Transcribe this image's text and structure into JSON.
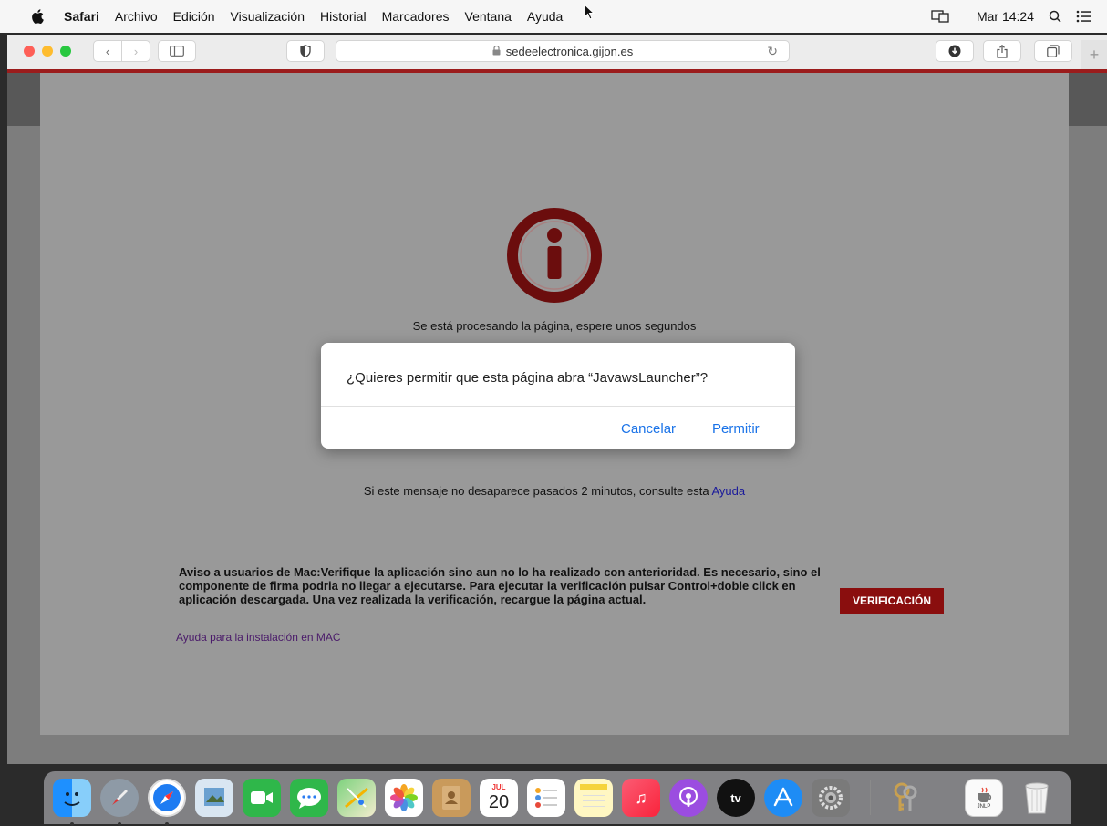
{
  "menubar": {
    "app_name": "Safari",
    "items": [
      "Archivo",
      "Edición",
      "Visualización",
      "Historial",
      "Marcadores",
      "Ventana",
      "Ayuda"
    ],
    "clock": "Mar 14:24"
  },
  "toolbar": {
    "url": "sedeelectronica.gijon.es"
  },
  "page": {
    "processing_text": "Se está procesando la página, espere unos segundos",
    "help_text": "Si este mensaje no desaparece pasados 2 minutos, consulte esta ",
    "help_link": "Ayuda",
    "notice": "Aviso a usuarios de Mac:Verifique la aplicación sino aun no lo ha realizado con anterioridad. Es necesario, sino el componente de firma podria no llegar a ejecutarse. Para ejecutar la verificación pulsar Control+doble click en aplicación descargada. Una vez realizada la verificación, recargue la página actual.",
    "mac_help_link": "Ayuda para la instalación en MAC",
    "verify_button": "VERIFICACIÓN",
    "accent_color": "#8a0e0e"
  },
  "dialog": {
    "question": "¿Quieres permitir que esta página abra “JavawsLauncher”?",
    "cancel_label": "Cancelar",
    "allow_label": "Permitir"
  },
  "dock": {
    "icons": [
      "finder-icon",
      "launchpad-icon",
      "safari-icon",
      "preview-icon",
      "facetime-icon",
      "messages-icon",
      "maps-icon",
      "photos-icon",
      "contacts-icon",
      "calendar-icon",
      "reminders-icon",
      "notes-icon",
      "music-icon",
      "podcasts-icon",
      "apple-tv-icon",
      "app-store-icon",
      "system-preferences-icon",
      "keychain-icon",
      "jnlp-file-icon",
      "trash-icon"
    ],
    "calendar_month": "JUL",
    "calendar_day": "20",
    "tv_label": "tv",
    "jnlp_label": "JNLP"
  }
}
